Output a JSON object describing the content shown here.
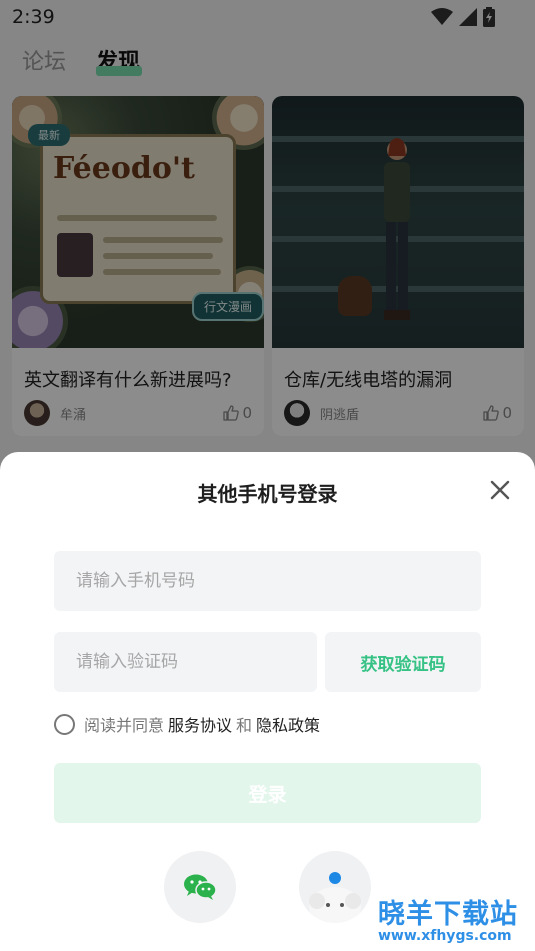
{
  "status_bar": {
    "time": "2:39"
  },
  "tabs": [
    {
      "label": "论坛"
    },
    {
      "label": "发现"
    }
  ],
  "feed": {
    "cards": [
      {
        "title": "英文翻译有什么新进展吗?",
        "author": "牟涌",
        "likes": "0",
        "image": {
          "badge": "最新",
          "poster_title": "Féeodo't",
          "bubble": "行文漫画"
        }
      },
      {
        "title": "仓库/无线电塔的漏洞",
        "author": "阴逃盾",
        "likes": "0"
      }
    ]
  },
  "login_sheet": {
    "title": "其他手机号登录",
    "phone_placeholder": "请输入手机号码",
    "code_placeholder": "请输入验证码",
    "get_code_label": "获取验证码",
    "agreement": {
      "prefix": "阅读并同意",
      "service_link": "服务协议",
      "conjunction": "和",
      "privacy_link": "隐私政策"
    },
    "login_label": "登录",
    "social": [
      {
        "icon": "wechat-icon"
      },
      {
        "icon": "other-login-icon"
      }
    ]
  },
  "watermark": {
    "text": "晓羊下载站",
    "url": "www.xfhygs.com"
  },
  "colors": {
    "accent_green": "#36c285",
    "login_disabled_bg": "#e3f6ec",
    "field_bg": "#f3f4f6",
    "tab_underline": "#7be0b0",
    "watermark_blue": "#2e8fe6"
  }
}
